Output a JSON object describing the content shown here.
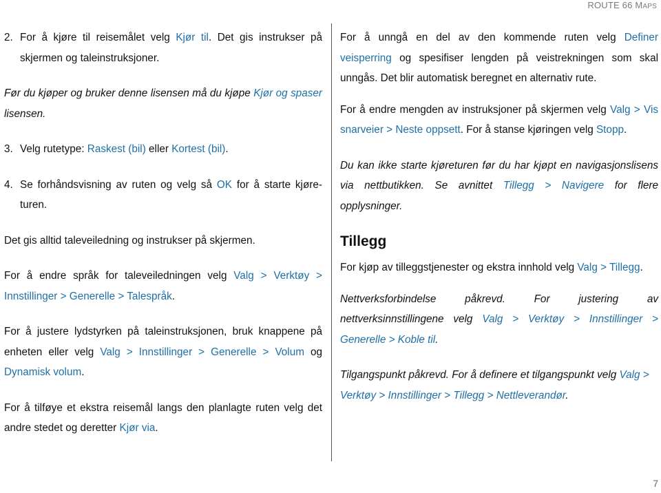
{
  "header": {
    "title_main": "ROUTE 66 M",
    "title_sc": "APS"
  },
  "left": {
    "step2": {
      "num": "2.",
      "t1": "For å kjøre til reisemålet velg ",
      "l1": "Kjør til",
      "t2": ". Det gis instrukser på skjermen og taleinstruksjoner."
    },
    "note_license": {
      "t1": "Før du kjøper og bruker denne lisensen må du kjøpe ",
      "l1": "Kjør og spaser",
      "t2": " lisensen."
    },
    "step3": {
      "num": "3.",
      "t1": "Velg rutetype: ",
      "l1": "Raskest (bil)",
      "t2": " eller ",
      "l2": "Kortest (bil)",
      "t3": "."
    },
    "step4": {
      "num": "4.",
      "t1": "Se forhåndsvisning av ruten og velg så ",
      "l1": "OK",
      "t2": " for å starte kjøre-turen."
    },
    "voice_always": "Det gis alltid taleveiledning og instrukser på skjermen.",
    "voice_language": {
      "t1": "For å endre språk for taleveiledningen velg ",
      "l1": "Valg > Verktøy > Innstillinger > Generelle > Talespråk",
      "t2": "."
    },
    "volume": {
      "t1": "For å justere lydstyrken på taleinstruksjonen, bruk knappene på enheten eller velg ",
      "l1": "Valg > Innstillinger > Generelle > Volum",
      "t2": " og ",
      "l2": "Dynamisk volum",
      "t3": "."
    },
    "via": {
      "t1": "For å tilføye et ekstra reisemål langs den planlagte ruten velg det andre stedet og deretter ",
      "l1": "Kjør via",
      "t2": "."
    }
  },
  "right": {
    "roadblock": {
      "t1": "For å unngå en del av den kommende ruten velg ",
      "l1": "Definer veisperring",
      "t2": " og spesifiser lengden på veistrekningen som skal unngås. Det blir automatisk beregnet en alternativ rute."
    },
    "instructions": {
      "t1": "For å endre mengden av instruksjoner på skjermen velg ",
      "l1": "Valg > Vis snarveier > Neste oppsett",
      "t2": ". For å stanse kjøringen velg ",
      "l2": "Stopp",
      "t3": "."
    },
    "note_nav": {
      "t1": "Du kan ikke starte kjøreturen før du har kjøpt en navigasjonslisens via nettbutikken. Se avnittet ",
      "l1": "Tillegg > Navigere",
      "t2": " for flere opplysninger."
    },
    "section_title": "Tillegg",
    "addons": {
      "t1": "For kjøp av tilleggstjenester og ekstra innhold velg ",
      "l1": "Valg > Tillegg",
      "t2": "."
    },
    "note_network": {
      "t1": "Nettverksforbindelse påkrevd. For justering av nettverksinnstillingene velg ",
      "l1": "Valg > Verktøy > Innstillinger > Generelle > Koble til",
      "t2": "."
    },
    "note_access": {
      "t1": "Tilgangspunkt påkrevd. For å definere et tilgangspunkt velg ",
      "l1": "Valg > Verktøy > Innstillinger > Tillegg > Nettleverandør",
      "t2": "."
    }
  },
  "footer": {
    "page_number": "7"
  },
  "colors": {
    "link": "#1f6fa6",
    "text": "#111111",
    "header": "#7a7a7a"
  }
}
